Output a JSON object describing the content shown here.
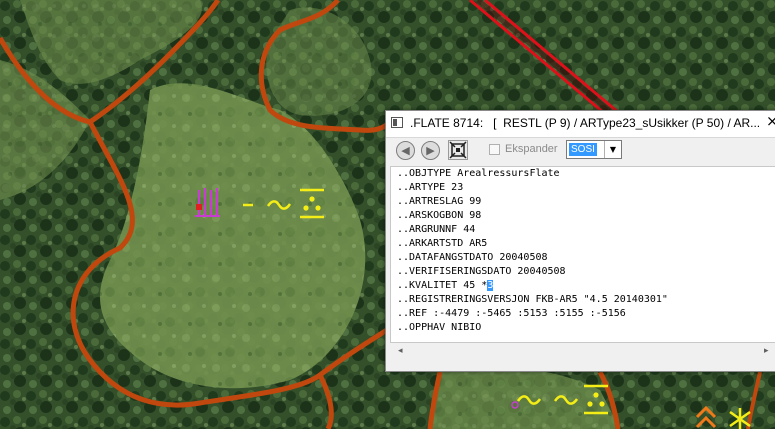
{
  "window": {
    "title": ".FLATE 8714:   [  RESTL (P 9) / ARType23_sUsikker (P 50) / AR...",
    "close_label": "×"
  },
  "toolbar": {
    "back_icon": "arrow-left-icon",
    "forward_icon": "arrow-right-icon",
    "zoom_icon": "zoom-to-object-icon",
    "expand_label": "Ekspander",
    "expand_checked": false,
    "format_value": "SOSI"
  },
  "content": {
    "lines": [
      "..OBJTYPE ArealressursFlate",
      "..ARTYPE 23",
      "..ARTRESLAG 99",
      "..ARSKOGBON 98",
      "..ARGRUNNF 44",
      "..ARKARTSTD AR5",
      "..DATAFANGSTDATO 20040508",
      "..VERIFISERINGSDATO 20040508",
      "..REGISTRERINGSVERSJON FKB-AR5 \"4.5 20140301\"",
      "..REF :-4479 :-5465 :5153 :5155 :-5156",
      "..OPPHAV NIBIO"
    ],
    "kvalitet_prefix": "..KVALITET 45 *",
    "kvalitet_selected": "3"
  },
  "scrollbar": {
    "left_arrow": "◂",
    "right_arrow": "▸"
  },
  "map": {
    "boundary_color": "#c0480e",
    "road_color": "#e0101a",
    "symbol_color_yellow": "#f4ee16",
    "symbol_color_magenta": "#c83cd2",
    "symbol_color_orange": "#f07a1a"
  }
}
